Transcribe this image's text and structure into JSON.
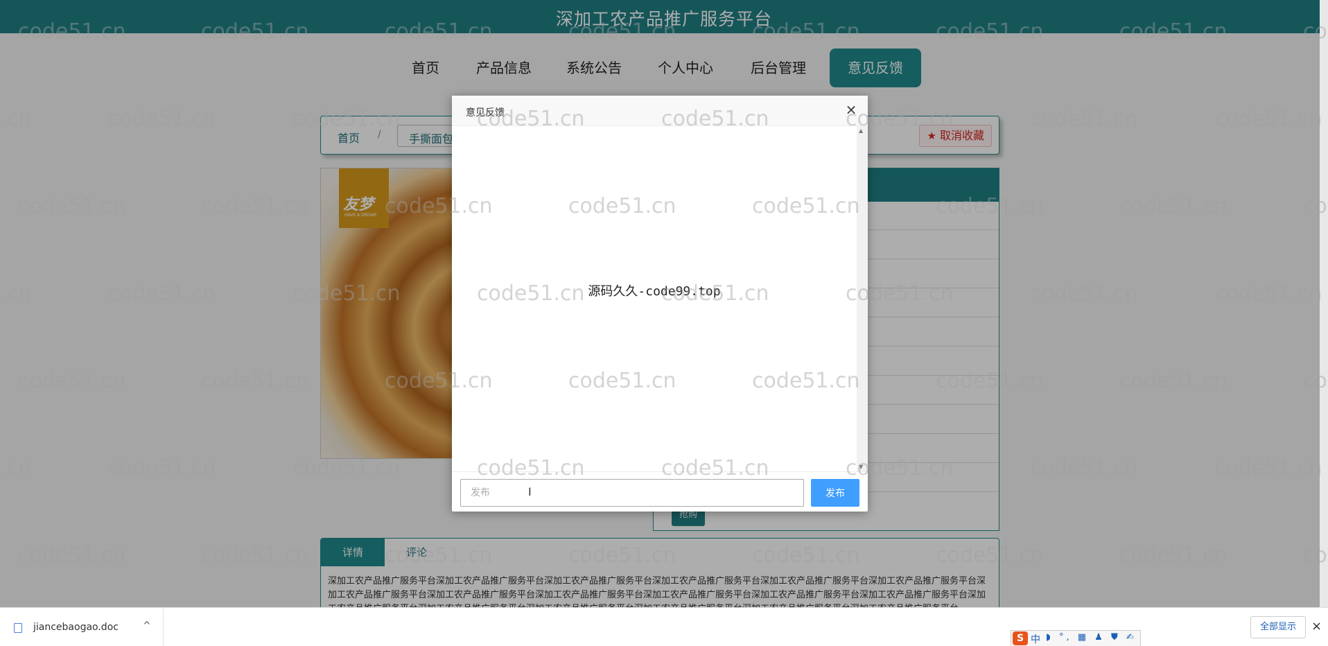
{
  "site": {
    "title": "深加工农产品推广服务平台"
  },
  "nav": {
    "items": [
      {
        "label": "首页"
      },
      {
        "label": "产品信息"
      },
      {
        "label": "系统公告"
      },
      {
        "label": "个人中心"
      },
      {
        "label": "后台管理"
      },
      {
        "label": "意见反馈"
      }
    ],
    "active": "意见反馈"
  },
  "breadcrumb": {
    "home": "首页",
    "separator": "/",
    "current": "手撕面包"
  },
  "favorite": {
    "label": "取消收藏",
    "icon": "star-icon"
  },
  "product": {
    "logo_main": "友梦",
    "logo_sub": "HAVE A DREAM"
  },
  "buy": {
    "label": "抢购"
  },
  "tabs": {
    "detail": "详情",
    "comments": "评论"
  },
  "detail_text": "深加工农产品推广服务平台深加工农产品推广服务平台深加工农产品推广服务平台深加工农产品推广服务平台深加工农产品推广服务平台深加工农产品推广服务平台深加工农产品推广服务平台深加工农产品推广服务平台深加工农产品推广服务平台深加工农产品推广服务平台深加工农产品推广服务平台深加工农产品推广服务平台深加工农产品推广服务平台深加工农产品推广服务平台深加工农产品推广服务平台深加工农产品推广服务平台深加工农产品推广服务平台深加工农产品推广服务平台",
  "modal": {
    "title": "意见反馈",
    "close": "×",
    "body_text": "源码久久-code99.top",
    "input_placeholder": "发布",
    "publish_label": "发布"
  },
  "watermark": {
    "text": "code51.cn"
  },
  "download_bar": {
    "file_name": "jiancebaogao.doc",
    "chevron": "^",
    "show_all": "全部显示",
    "close": "×",
    "ime_logo": "S",
    "ime_lang": "中",
    "ime_tools": "◗ °, ▦ ♟ ⛊ ✍"
  },
  "colors": {
    "primary": "#1f7f84",
    "publish": "#409eff",
    "favorite": "#d9261c"
  }
}
